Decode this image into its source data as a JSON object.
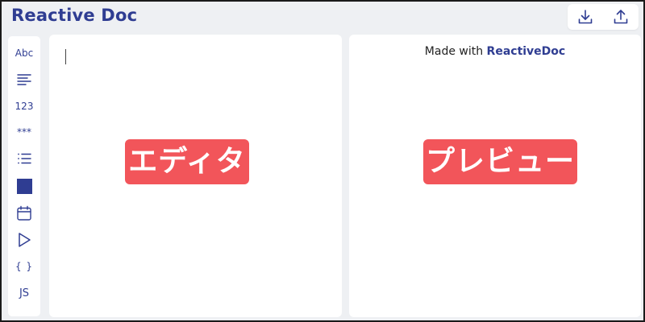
{
  "header": {
    "title": "Reactive Doc",
    "actions": [
      {
        "icon": "download-icon"
      },
      {
        "icon": "upload-icon"
      }
    ]
  },
  "sidebar": {
    "items": [
      {
        "label": "Abc",
        "icon": "text-input-icon"
      },
      {
        "label": "",
        "icon": "textarea-icon"
      },
      {
        "label": "123",
        "icon": "number-input-icon"
      },
      {
        "label": "***",
        "icon": "password-input-icon"
      },
      {
        "label": "",
        "icon": "list-icon"
      },
      {
        "label": "",
        "icon": "color-picker-icon"
      },
      {
        "label": "",
        "icon": "calendar-icon"
      },
      {
        "label": "",
        "icon": "play-icon"
      },
      {
        "label": "{ }",
        "icon": "code-braces-icon"
      },
      {
        "label": "JS",
        "icon": "javascript-icon"
      }
    ]
  },
  "editor": {
    "overlay_label": "エディタ"
  },
  "preview": {
    "made_with_prefix": "Made with",
    "made_with_brand": "ReactiveDoc",
    "overlay_label": "プレビュー"
  },
  "colors": {
    "brand": "#2f3d92",
    "label_bg": "#f2555a",
    "background": "#eef0f3"
  }
}
